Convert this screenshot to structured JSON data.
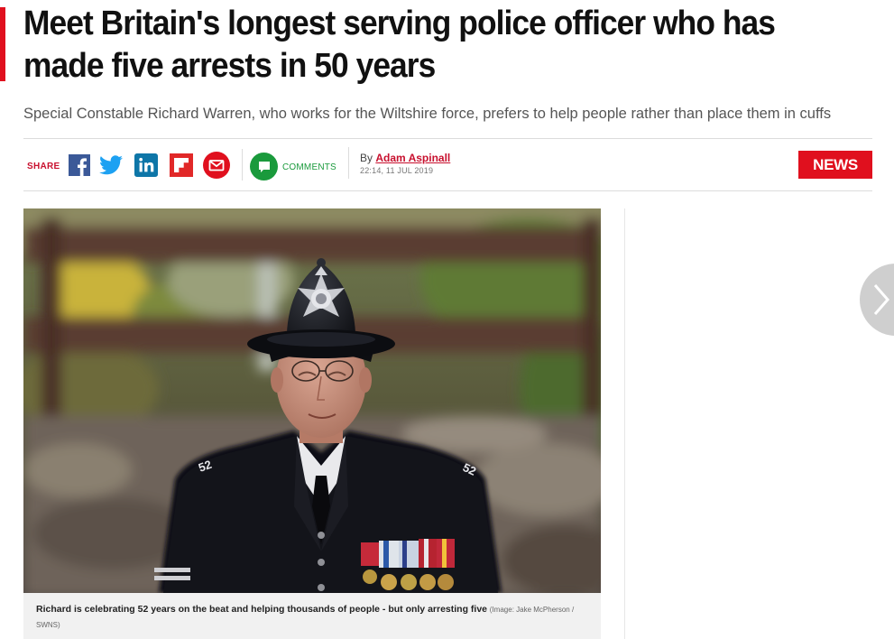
{
  "article": {
    "headline": "Meet Britain's longest serving police officer who has made five arrests in 50 years",
    "standfirst": "Special Constable Richard Warren, who works for the Wiltshire force, prefers to help people rather than place them in cuffs"
  },
  "share_bar": {
    "label": "SHARE",
    "icons": [
      "facebook-icon",
      "twitter-icon",
      "linkedin-icon",
      "flipboard-icon",
      "email-icon"
    ],
    "comments_label": "COMMENTS",
    "byline_prefix": "By",
    "author": "Adam Aspinall",
    "timestamp": "22:14, 11 JUL 2019",
    "section_badge": "NEWS"
  },
  "hero": {
    "caption": "Richard is celebrating 52 years on the beat and helping thousands of people - but only arresting five",
    "credit": "(Image: Jake McPherson / SWNS)"
  },
  "carousel": {
    "next_icon": "chevron-right-icon"
  },
  "colors": {
    "brand_red": "#e0101e",
    "facebook": "#3b5998",
    "twitter": "#1da1f2",
    "linkedin": "#0e76a8",
    "flipboard": "#e12828",
    "comments_green": "#1a9a3c"
  }
}
